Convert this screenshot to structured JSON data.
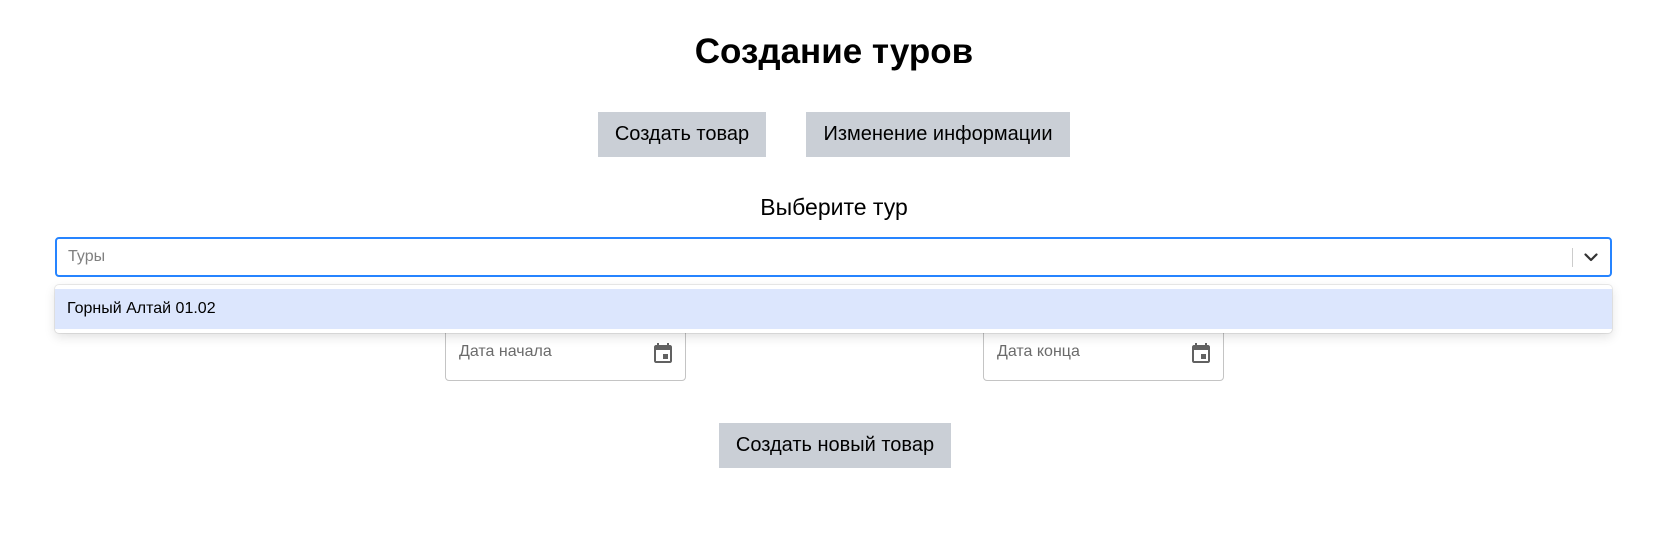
{
  "page": {
    "title": "Создание туров"
  },
  "toolbar": {
    "create_product_label": "Создать товар",
    "edit_info_label": "Изменение информации"
  },
  "tour_select": {
    "label": "Выберите тур",
    "placeholder": "Туры",
    "options": [
      {
        "label": "Горный Алтай 01.02"
      }
    ],
    "chevron_icon": "chevron-down-icon"
  },
  "dates": {
    "start_placeholder": "Дата начала",
    "end_placeholder": "Дата конца",
    "calendar_icon": "calendar-icon"
  },
  "actions": {
    "create_new_label": "Создать новый товар"
  },
  "colors": {
    "button_bg": "#cacfd6",
    "focus_border": "#2684ff",
    "option_highlight": "#dce6fd"
  }
}
